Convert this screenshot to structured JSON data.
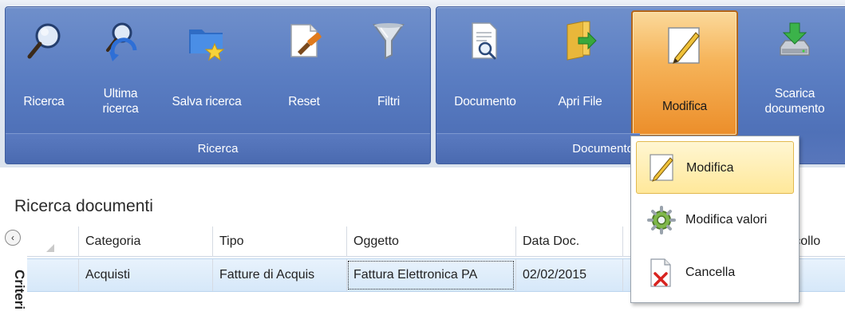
{
  "ribbon": {
    "groups": [
      {
        "label": "Ricerca",
        "buttons": [
          {
            "label": "Ricerca",
            "icon": "magnifier-icon"
          },
          {
            "label": "Ultima ricerca",
            "icon": "last-search-icon"
          },
          {
            "label": "Salva ricerca",
            "icon": "save-search-folder-icon"
          },
          {
            "label": "Reset",
            "icon": "reset-brush-icon"
          },
          {
            "label": "Filtri",
            "icon": "filter-funnel-icon"
          }
        ]
      },
      {
        "label": "Documento",
        "buttons": [
          {
            "label": "Documento",
            "icon": "document-search-icon"
          },
          {
            "label": "Apri File",
            "icon": "open-file-icon"
          },
          {
            "label": "Modifica",
            "icon": "edit-pencil-icon",
            "active": true
          },
          {
            "label": "Scarica documento",
            "icon": "download-drive-icon"
          }
        ]
      }
    ]
  },
  "page": {
    "title": "Ricerca documenti",
    "collapse_glyph": "‹",
    "side_panel_label": "Criteri"
  },
  "grid": {
    "columns": [
      "Categoria",
      "Tipo",
      "Oggetto",
      "Data Doc.",
      "",
      "Protocollo"
    ],
    "rows": [
      [
        "Acquisti",
        "Fatture di Acquis",
        "Fattura Elettronica PA",
        "02/02/2015",
        "",
        ""
      ]
    ]
  },
  "dropdown": {
    "items": [
      {
        "label": "Modifica",
        "icon": "edit-pencil-icon",
        "highlighted": true
      },
      {
        "label": "Modifica valori",
        "icon": "gear-icon"
      },
      {
        "label": "Cancella",
        "icon": "delete-document-icon"
      }
    ]
  },
  "colors": {
    "ribbon_blue": "#5a7dc2",
    "active_orange": "#f6b45a",
    "row_selected": "#d6e8f9",
    "menu_highlight": "#ffe89a"
  }
}
